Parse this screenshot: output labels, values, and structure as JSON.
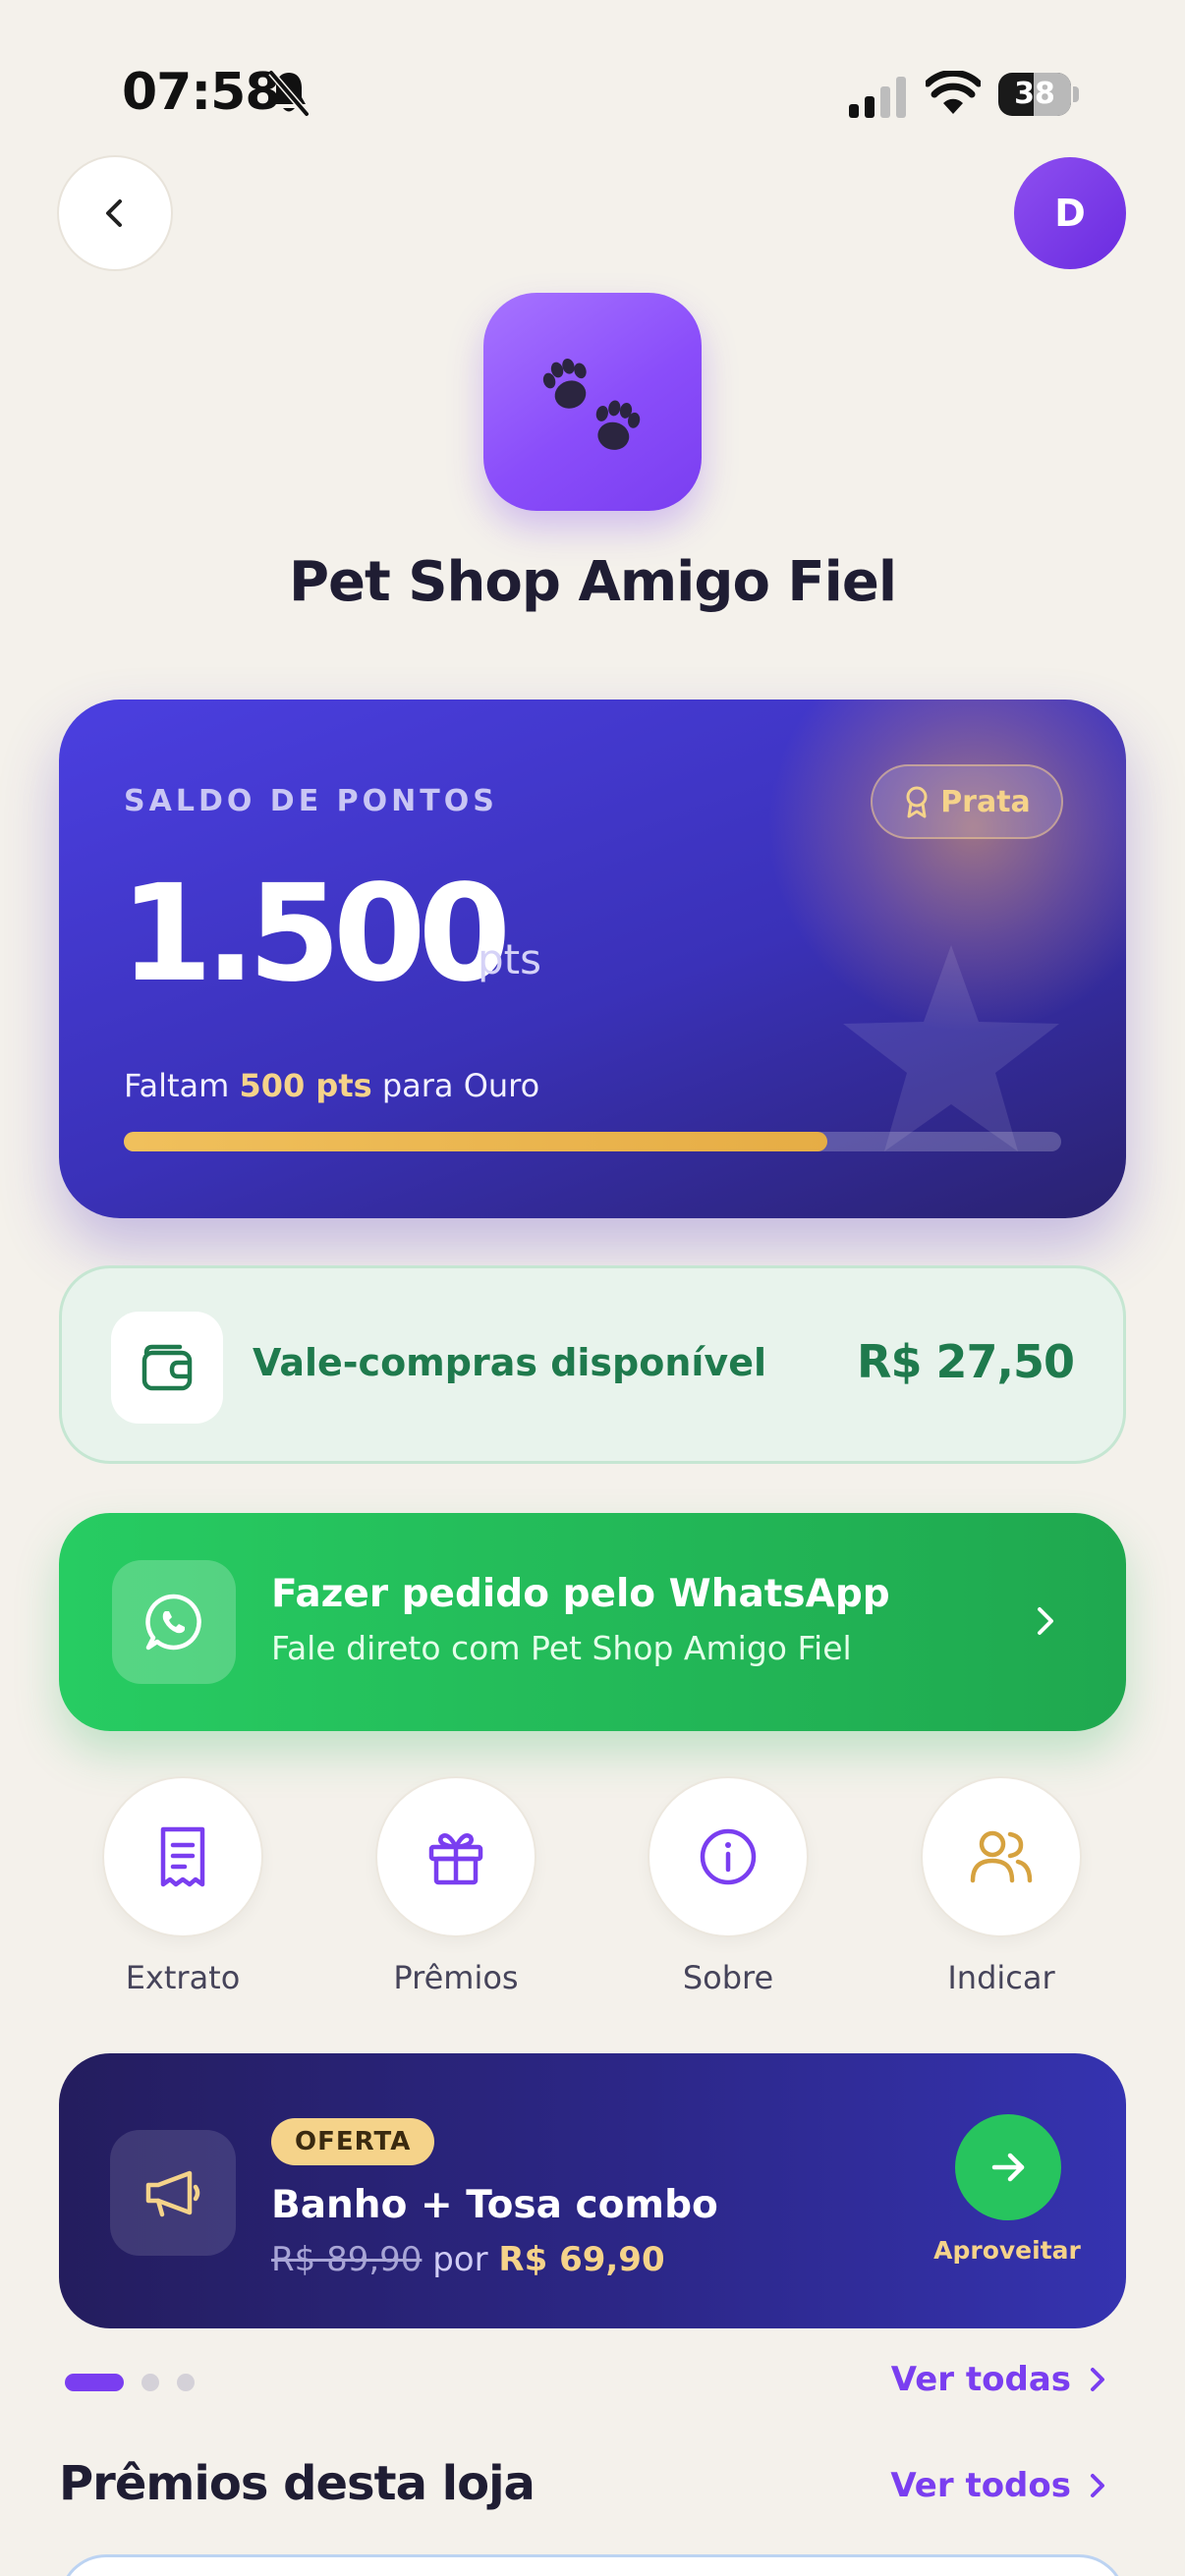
{
  "status_bar": {
    "time": "07:58",
    "battery": "38"
  },
  "nav": {
    "avatar_initial": "D"
  },
  "store": {
    "name": "Pet Shop Amigo Fiel"
  },
  "points_card": {
    "label": "SALDO DE PONTOS",
    "tier": "Prata",
    "points": "1.500",
    "unit": "pts",
    "progress_prefix": "Faltam ",
    "progress_highlight": "500 pts",
    "progress_suffix": " para Ouro",
    "progress_fraction": 0.75,
    "colors": {
      "gradient_start": "#4b3fe0",
      "gradient_end": "#2a2270",
      "gold": "#f5d38a"
    }
  },
  "voucher": {
    "label": "Vale-compras disponível",
    "amount": "R$ 27,50"
  },
  "whatsapp": {
    "title": "Fazer pedido pelo WhatsApp",
    "subtitle": "Fale direto com Pet Shop Amigo Fiel"
  },
  "quick_actions": [
    {
      "label": "Extrato",
      "icon": "receipt-icon"
    },
    {
      "label": "Prêmios",
      "icon": "gift-icon"
    },
    {
      "label": "Sobre",
      "icon": "info-icon"
    },
    {
      "label": "Indicar",
      "icon": "users-icon"
    }
  ],
  "promo": {
    "badge": "OFERTA",
    "title": "Banho + Tosa combo",
    "old_price": "R$ 89,90",
    "connector": " por ",
    "new_price": "R$ 69,90",
    "cta": "Aproveitar"
  },
  "carousel": {
    "count": 3,
    "active": 0
  },
  "offers_link": "Ver todas",
  "rewards_section": {
    "title": "Prêmios desta loja",
    "link": "Ver todos"
  }
}
